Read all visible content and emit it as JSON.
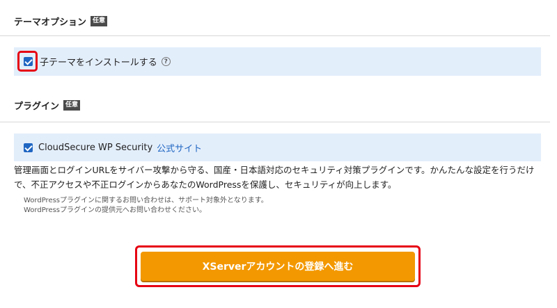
{
  "theme_options": {
    "heading": "テーマオプション",
    "badge": "任意",
    "child_theme": {
      "checked": true,
      "label": "子テーマをインストールする",
      "help": "?"
    }
  },
  "plugins": {
    "heading": "プラグイン",
    "badge": "任意",
    "cloudsecure": {
      "checked": true,
      "label": "CloudSecure WP Security",
      "link_label": "公式サイト",
      "description": "管理画面とログインURLをサイバー攻撃から守る、国産・日本語対応のセキュリティ対策プラグインです。かんたんな設定を行うだけで、不正アクセスや不正ログインからあなたのWordPressを保護し、セキュリティが向上します。",
      "note_line1": "WordPressプラグインに関するお問い合わせは、サポート対象外となります。",
      "note_line2": "WordPressプラグインの提供元へお問い合わせください。"
    }
  },
  "cta": {
    "label": "XServerアカウントの登録へ進む"
  },
  "colors": {
    "accent_blue": "#1f66c2",
    "option_bg": "#e3eefb",
    "cta_orange": "#f39800",
    "highlight_red": "#e60012"
  }
}
